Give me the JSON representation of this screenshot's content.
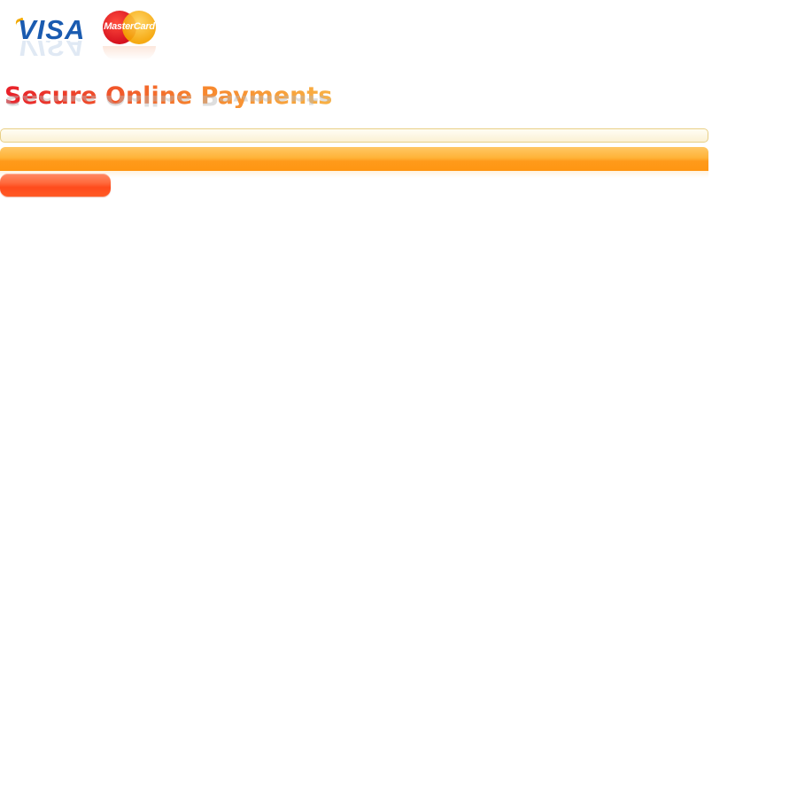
{
  "header": {
    "logos": [
      {
        "name": "Visa",
        "text": "VISA",
        "color": "#1a5bb0"
      },
      {
        "name": "MasterCard",
        "text": "MasterCard",
        "colors": [
          "#d6121f",
          "#f5a300"
        ]
      }
    ],
    "title": "Secure Online Payments"
  },
  "colors": {
    "title_gradient_start": "#e8202a",
    "title_gradient_end": "#f9b143",
    "bar_orange": "#ff9a1a",
    "button_red": "#ff4b1c",
    "field_border": "#e8cf86"
  },
  "form": {
    "field_value": "",
    "button_label": ""
  }
}
